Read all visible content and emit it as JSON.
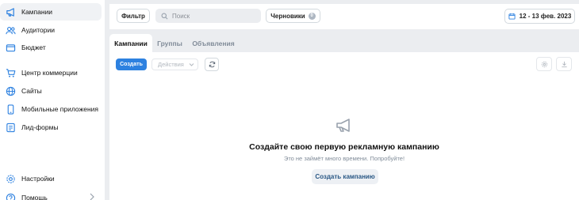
{
  "sidebar": {
    "items": [
      {
        "label": "Кампании",
        "icon": "megaphone-icon",
        "active": true
      },
      {
        "label": "Аудитории",
        "icon": "users-icon"
      },
      {
        "label": "Бюджет",
        "icon": "wallet-icon"
      },
      {
        "label": "Центр коммерции",
        "icon": "cart-icon"
      },
      {
        "label": "Сайты",
        "icon": "globe-icon"
      },
      {
        "label": "Мобильные приложения",
        "icon": "phone-icon"
      },
      {
        "label": "Лид-формы",
        "icon": "form-icon"
      },
      {
        "label": "Настройки",
        "icon": "gear-icon"
      },
      {
        "label": "Помощь",
        "icon": "help-icon"
      }
    ]
  },
  "topbar": {
    "filter_label": "Фильтр",
    "search_placeholder": "Поиск",
    "drafts_label": "Черновики",
    "drafts_count": "0",
    "date_range": "12 - 13 фев. 2023"
  },
  "tabs": [
    {
      "label": "Кампании",
      "active": true
    },
    {
      "label": "Группы"
    },
    {
      "label": "Объявления"
    }
  ],
  "toolbar": {
    "create_label": "Создать",
    "actions_label": "Действия"
  },
  "empty_state": {
    "title": "Создайте свою первую рекламную кампанию",
    "subtitle": "Это не займёт много времени. Попробуйте!",
    "button_label": "Создать кампанию"
  },
  "colors": {
    "accent": "#2d81e0",
    "background": "#ebedf0"
  }
}
